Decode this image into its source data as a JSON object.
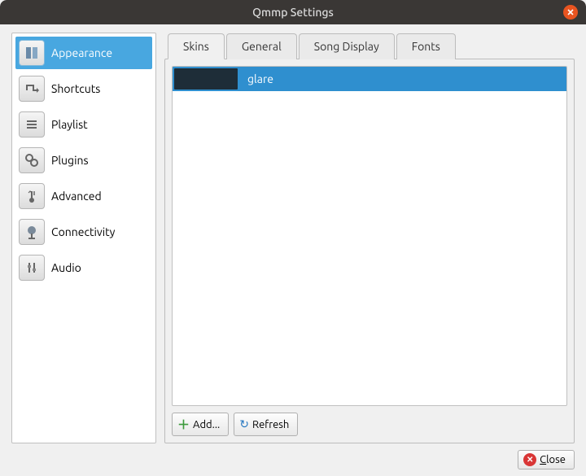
{
  "window": {
    "title": "Qmmp Settings"
  },
  "sidebar": {
    "items": [
      {
        "label": "Appearance"
      },
      {
        "label": "Shortcuts"
      },
      {
        "label": "Playlist"
      },
      {
        "label": "Plugins"
      },
      {
        "label": "Advanced"
      },
      {
        "label": "Connectivity"
      },
      {
        "label": "Audio"
      }
    ]
  },
  "tabs": [
    {
      "label": "Skins"
    },
    {
      "label": "General"
    },
    {
      "label": "Song Display"
    },
    {
      "label": "Fonts"
    }
  ],
  "skins": [
    {
      "name": "glare"
    }
  ],
  "buttons": {
    "add": "Add...",
    "refresh": "Refresh",
    "close": "lose",
    "close_accel": "C"
  }
}
